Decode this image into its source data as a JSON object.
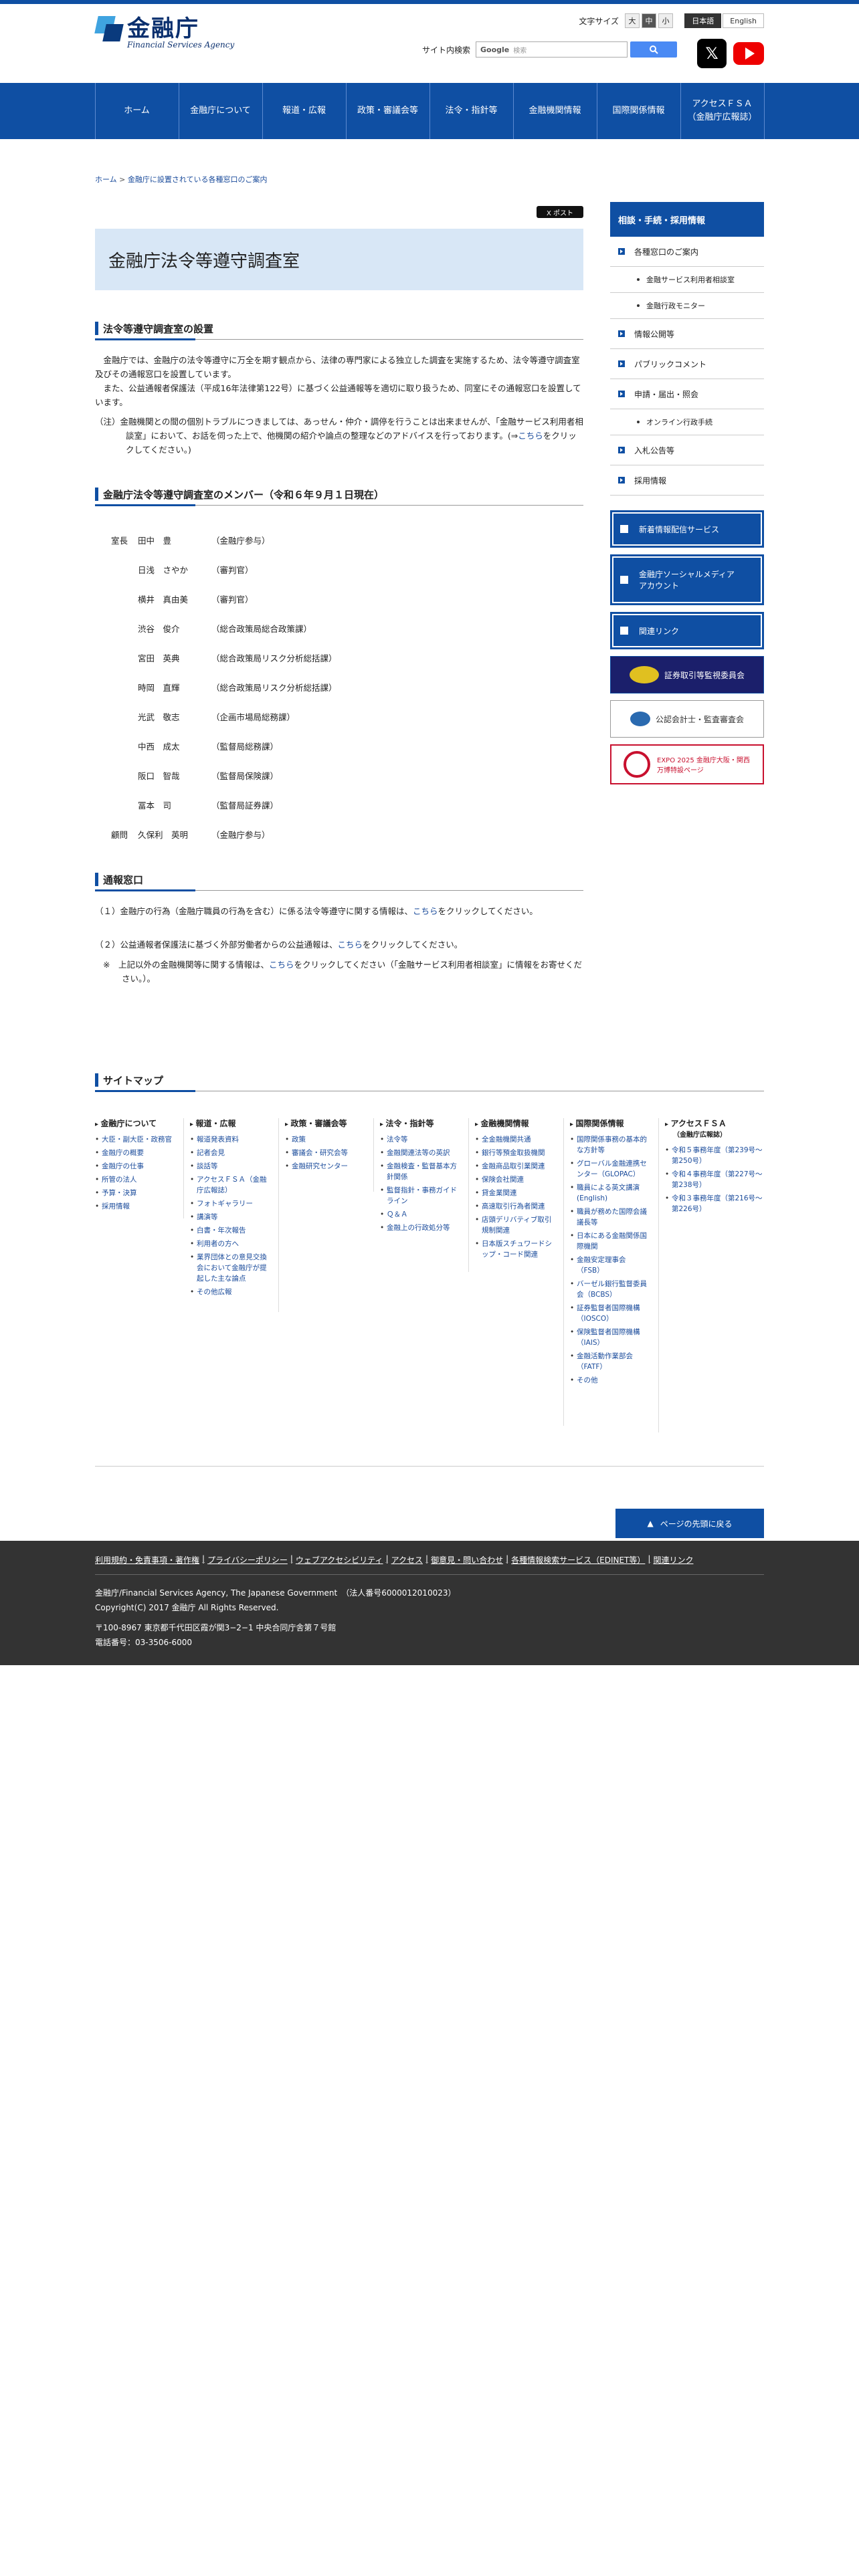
{
  "header": {
    "logo_jp": "金融庁",
    "logo_en": "Financial Services Agency",
    "textsize_label": "文字サイズ",
    "textsize_options": [
      "大",
      "中",
      "小"
    ],
    "lang_jp": "日本語",
    "lang_en": "English",
    "search_label": "サイト内検索",
    "search_brand": "Google",
    "search_placeholder": "検索"
  },
  "gnav": [
    "ホーム",
    "金融庁について",
    "報道・広報",
    "政策・審議会等",
    "法令・指針等",
    "金融機関情報",
    "国際関係情報",
    "アクセスＦＳＡ\n（金融庁広報誌）"
  ],
  "breadcrumb": {
    "home": "ホーム",
    "sep": ">",
    "parent": "金融庁に設置されている各種窓口のご案内"
  },
  "tweet": "X ポスト",
  "page_title": "金融庁法令等遵守調査室",
  "section1": {
    "heading": "法令等遵守調査室の設置",
    "p1": "　金融庁では、金融庁の法令等遵守に万全を期す観点から、法律の専門家による独立した調査を実施するため、法令等遵守調査室及びその通報窓口を設置しています。",
    "p2": "　また、公益通報者保護法（平成16年法律第122号）に基づく公益通報等を適切に取り扱うため、同室にその通報窓口を設置しています。",
    "note_pre": "（注）金融機関との間の個別トラブルにつきましては、あっせん・仲介・調停を行うことは出来ませんが、「金融サービス利用者相談室」において、お話を伺った上で、他機関の紹介や論点の整理などのアドバイスを行っております。(⇒",
    "note_link": "こちら",
    "note_post": "をクリックしてください。)"
  },
  "section2": {
    "heading": "金融庁法令等遵守調査室のメンバー（令和６年９月１日現在）",
    "members": [
      {
        "role": "室長",
        "name": "田中　豊",
        "aff": "（金融庁参与）"
      },
      {
        "role": "",
        "name": "日浅　さやか",
        "aff": "（審判官）"
      },
      {
        "role": "",
        "name": "横井　真由美",
        "aff": "（審判官）"
      },
      {
        "role": "",
        "name": "渋谷　俊介",
        "aff": "（総合政策局総合政策課）"
      },
      {
        "role": "",
        "name": "宮田　英典",
        "aff": "（総合政策局リスク分析総括課）"
      },
      {
        "role": "",
        "name": "時岡　直輝",
        "aff": "（総合政策局リスク分析総括課）"
      },
      {
        "role": "",
        "name": "光武　敬志",
        "aff": "（企画市場局総務課）"
      },
      {
        "role": "",
        "name": "中西　成太",
        "aff": "（監督局総務課）"
      },
      {
        "role": "",
        "name": "阪口　智哉",
        "aff": "（監督局保険課）"
      },
      {
        "role": "",
        "name": "冨本　司",
        "aff": "（監督局証券課）"
      },
      {
        "role": "顧問",
        "name": "久保利　英明",
        "aff": "（金融庁参与）"
      }
    ]
  },
  "section3": {
    "heading": "通報窓口",
    "i1_pre": "（１）金融庁の行為（金融庁職員の行為を含む）に係る法令等遵守に関する情報は、",
    "i1_link": "こちら",
    "i1_post": "をクリックしてください。",
    "i2_pre": "（２）公益通報者保護法に基づく外部労働者からの公益通報は、",
    "i2_link": "こちら",
    "i2_post": "をクリックしてください。",
    "i3_pre": "※　上記以外の金融機関等に関する情報は、",
    "i3_link": "こちら",
    "i3_post": "をクリックしてください（「金融サービス利用者相談室」に情報をお寄せください。）。"
  },
  "sidebar": {
    "head": "相談・手続・採用情報",
    "items": [
      {
        "label": "各種窓口のご案内",
        "level": 1
      },
      {
        "label": "金融サービス利用者相談室",
        "level": 2
      },
      {
        "label": "金融行政モニター",
        "level": 2
      },
      {
        "label": "情報公開等",
        "level": 1
      },
      {
        "label": "パブリックコメント",
        "level": 1
      },
      {
        "label": "申請・届出・照会",
        "level": 1
      },
      {
        "label": "オンライン行政手続",
        "level": 2
      },
      {
        "label": "入札公告等",
        "level": 1
      },
      {
        "label": "採用情報",
        "level": 1
      }
    ],
    "banners": [
      {
        "label": "新着情報配信サービス",
        "style": "blue"
      },
      {
        "label": "金融庁ソーシャルメディアアカウント",
        "style": "blue"
      },
      {
        "label": "関連リンク",
        "style": "blue"
      },
      {
        "label": "証券取引等監視委員会",
        "style": "navy"
      },
      {
        "label": "公認会計士・監査審査会",
        "style": "white"
      },
      {
        "label": "EXPO 2025 金融庁大阪・関西万博特設ページ",
        "style": "expo"
      }
    ]
  },
  "sitemap": {
    "heading": "サイトマップ",
    "columns": [
      {
        "title": "金融庁について",
        "items": [
          "大臣・副大臣・政務官",
          "金融庁の概要",
          "金融庁の仕事",
          "所管の法人",
          "予算・決算",
          "採用情報"
        ]
      },
      {
        "title": "報道・広報",
        "items": [
          "報道発表資料",
          "記者会見",
          "談話等",
          "アクセスＦＳＡ（金融庁広報誌）",
          "フォトギャラリー",
          "講演等",
          "白書・年次報告",
          "利用者の方へ",
          "業界団体との意見交換会において金融庁が提起した主な論点",
          "その他広報"
        ]
      },
      {
        "title": "政策・審議会等",
        "items": [
          "政策",
          "審議会・研究会等",
          "金融研究センター"
        ]
      },
      {
        "title": "法令・指針等",
        "items": [
          "法令等",
          "金融関連法等の英訳",
          "金融検査・監督基本方針関係",
          "監督指針・事務ガイドライン",
          "Ｑ＆Ａ",
          "金融上の行政処分等"
        ]
      },
      {
        "title": "金融機関情報",
        "items": [
          "全金融機関共通",
          "銀行等預金取扱機関",
          "金融商品取引業関連",
          "保険会社関連",
          "貸金業関連",
          "高速取引行為者関連",
          "店頭デリバティブ取引規制関連",
          "日本版スチュワードシップ・コード関連"
        ]
      },
      {
        "title": "国際関係情報",
        "items": [
          "国際関係事務の基本的な方針等",
          "グローバル金融連携センター（GLOPAC）",
          "職員による英文講演(English)",
          "職員が務めた国際会議議長等",
          "日本にある金融関係国際機関",
          "金融安定理事会（FSB）",
          "バーゼル銀行監督委員会（BCBS）",
          "証券監督者国際機構（IOSCO）",
          "保険監督者国際機構（IAIS）",
          "金融活動作業部会（FATF）",
          "その他"
        ]
      },
      {
        "title": "アクセスＦＳＡ",
        "sub": "（金融庁広報誌）",
        "items": [
          "令和５事務年度（第239号〜第250号）",
          "令和４事務年度（第227号〜第238号）",
          "令和３事務年度（第216号〜第226号）"
        ]
      }
    ],
    "pagetop": "ページの先頭に戻る"
  },
  "footer": {
    "links": [
      "利用規約・免責事項・著作権",
      "プライバシーポリシー",
      "ウェブアクセシビリティ",
      "アクセス",
      "御意見・問い合わせ",
      "各種情報検索サービス（EDINET等）",
      "関連リンク"
    ],
    "org": "金融庁/Financial Services Agency, The Japanese Government　（法人番号6000012010023）",
    "copyright": "Copyright(C) 2017 金融庁 All Rights Reserved.",
    "address": "〒100-8967 東京都千代田区霞が関3−2−1 中央合同庁舎第７号館",
    "tel": "電話番号：03-3506-6000"
  },
  "colors": {
    "primary": "#0f4fa3",
    "title_bg": "#d8e7f6",
    "footer_bg": "#333333"
  }
}
